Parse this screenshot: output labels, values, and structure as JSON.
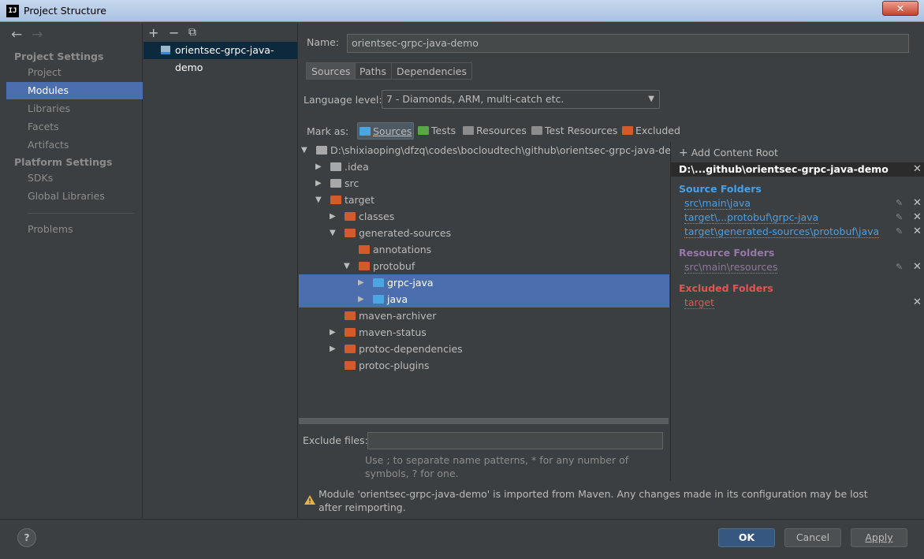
{
  "window": {
    "title": "Project Structure",
    "app_icon": "IJ",
    "close": "✕"
  },
  "nav": {
    "back": "←",
    "forward": "→",
    "project_settings": "Project Settings",
    "platform_settings": "Platform Settings",
    "items": [
      "Project",
      "Modules",
      "Libraries",
      "Facets",
      "Artifacts"
    ],
    "platform_items": [
      "SDKs",
      "Global Libraries"
    ],
    "problems": "Problems"
  },
  "modules": {
    "add": "+",
    "remove": "−",
    "copy": "⧉",
    "selected": "orientsec-grpc-java-demo"
  },
  "main": {
    "name_label": "Name:",
    "name_value": "orientsec-grpc-java-demo",
    "tabs": [
      "Sources",
      "Paths",
      "Dependencies"
    ],
    "language_label": "Language level:",
    "language_value": "7 - Diamonds, ARM, multi-catch etc.",
    "mark_as_label": "Mark as:",
    "mark_as": [
      "Sources",
      "Tests",
      "Resources",
      "Test Resources",
      "Excluded"
    ],
    "tree": [
      {
        "label": "D:\\shixiaoping\\dfzq\\codes\\bocloudtech\\github\\orientsec-grpc-java-demo",
        "depth": 0,
        "arrow": "▼",
        "folder": "grey"
      },
      {
        "label": ".idea",
        "depth": 1,
        "arrow": "▶",
        "folder": "grey"
      },
      {
        "label": "src",
        "depth": 1,
        "arrow": "▶",
        "folder": "grey"
      },
      {
        "label": "target",
        "depth": 1,
        "arrow": "▼",
        "folder": "orange"
      },
      {
        "label": "classes",
        "depth": 2,
        "arrow": "▶",
        "folder": "orange"
      },
      {
        "label": "generated-sources",
        "depth": 2,
        "arrow": "▼",
        "folder": "orange"
      },
      {
        "label": "annotations",
        "depth": 3,
        "arrow": "",
        "folder": "orange"
      },
      {
        "label": "protobuf",
        "depth": 3,
        "arrow": "▼",
        "folder": "orange"
      },
      {
        "label": "grpc-java",
        "depth": 4,
        "arrow": "▶",
        "folder": "blue",
        "selected": true
      },
      {
        "label": "java",
        "depth": 4,
        "arrow": "▶",
        "folder": "blue",
        "selected": true
      },
      {
        "label": "maven-archiver",
        "depth": 2,
        "arrow": "",
        "folder": "orange"
      },
      {
        "label": "maven-status",
        "depth": 2,
        "arrow": "▶",
        "folder": "orange"
      },
      {
        "label": "protoc-dependencies",
        "depth": 2,
        "arrow": "▶",
        "folder": "orange"
      },
      {
        "label": "protoc-plugins",
        "depth": 2,
        "arrow": "",
        "folder": "orange"
      }
    ],
    "exclude_label": "Exclude files:",
    "exclude_value": "",
    "exclude_hint": "Use ; to separate name patterns, * for any number of symbols, ? for one.",
    "warning": "Module 'orientsec-grpc-java-demo' is imported from Maven. Any changes made in its configuration may be lost after reimporting."
  },
  "content_root": {
    "add": "Add Content Root",
    "root": "D:\\...github\\orientsec-grpc-java-demo",
    "source_title": "Source Folders",
    "source_items": [
      "src\\main\\java",
      "target\\...protobuf\\grpc-java",
      "target\\generated-sources\\protobuf\\java"
    ],
    "resource_title": "Resource Folders",
    "resource_items": [
      "src\\main\\resources"
    ],
    "excluded_title": "Excluded Folders",
    "excluded_items": [
      "target"
    ]
  },
  "footer": {
    "help": "?",
    "ok": "OK",
    "cancel": "Cancel",
    "apply": "Apply"
  },
  "colors": {
    "source": "#4a9fe3",
    "resource": "#9876aa",
    "excluded": "#e05555",
    "selection": "#4b6eaf"
  }
}
